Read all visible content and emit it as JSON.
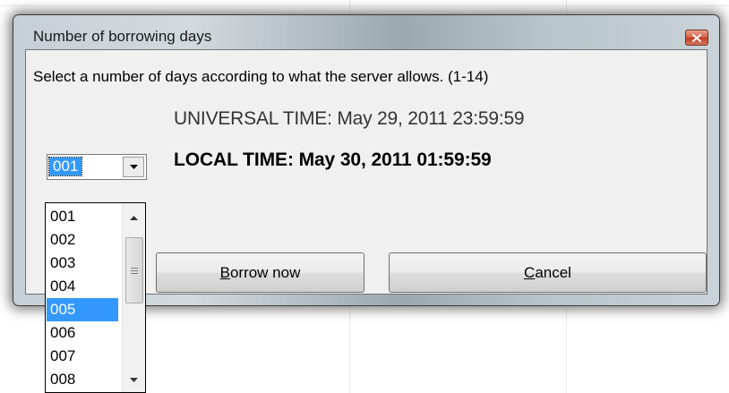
{
  "window": {
    "title": "Number of borrowing days"
  },
  "dialog": {
    "instruction": "Select a number of days according to what the server allows. (1-14)",
    "universal_time": "UNIVERSAL TIME: May 29, 2011 23:59:59",
    "local_time": "LOCAL TIME: May 30, 2011 01:59:59"
  },
  "days_combo": {
    "selected_value": "001",
    "options": [
      "001",
      "002",
      "003",
      "004",
      "005",
      "006",
      "007",
      "008"
    ],
    "highlighted_option": "005"
  },
  "buttons": {
    "borrow_accel": "B",
    "borrow_rest": "orrow now",
    "cancel_accel": "C",
    "cancel_rest": "ancel"
  },
  "icons": {
    "close": "close-icon",
    "combo_arrow": "chevron-down-icon",
    "scroll_up": "arrow-up-icon",
    "scroll_down": "arrow-down-icon",
    "scroll_grip": "grip-icon"
  },
  "colors": {
    "selection": "#3399ff",
    "close_button": "#c94a31",
    "client_background": "#f0f0f0"
  }
}
